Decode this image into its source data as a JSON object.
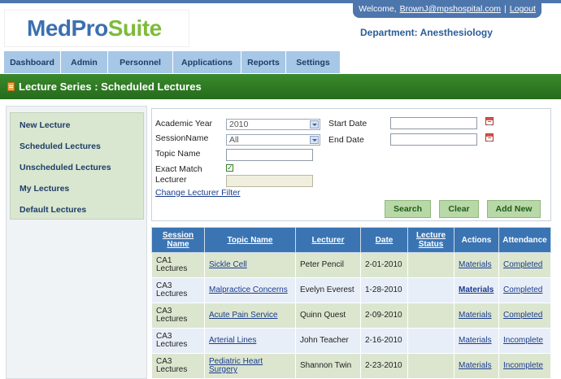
{
  "app": {
    "logo_part1": "MedPro",
    "logo_part2": "Suite",
    "welcome_prefix": "Welcome,",
    "user_email": "BrownJ@mpshospital.com",
    "separator": "|",
    "logout_label": "Logout",
    "department": "Department: Anesthesiology"
  },
  "nav": {
    "tabs": [
      "Dashboard",
      "Admin",
      "Personnel",
      "Applications",
      "Reports",
      "Settings"
    ]
  },
  "page": {
    "title": "Lecture Series : Scheduled Lectures"
  },
  "sidebar": {
    "items": [
      "New Lecture",
      "Scheduled Lectures",
      "Unscheduled Lectures",
      "My Lectures",
      "Default Lectures"
    ]
  },
  "filters": {
    "academic_year_label": "Academic Year",
    "academic_year_value": "2010",
    "session_name_label": "SessionName",
    "session_name_value": "All",
    "topic_name_label": "Topic Name",
    "topic_name_value": "",
    "exact_match_label": "Exact Match",
    "exact_match_checked": "✓",
    "lecturer_label": "Lecturer",
    "lecturer_value": "",
    "change_lecturer_label": "Change Lecturer Filter",
    "start_date_label": "Start Date",
    "end_date_label": "End Date",
    "search_label": "Search",
    "clear_label": "Clear",
    "add_new_label": "Add New"
  },
  "table": {
    "headers": {
      "session_name": "Session Name",
      "topic_name": "Topic Name",
      "lecturer": "Lecturer",
      "date": "Date",
      "lecture_status": "Lecture Status",
      "actions": "Actions",
      "attendance": "Attendance"
    },
    "rows": [
      {
        "session_name": "CA1 Lectures",
        "topic_name": "Sickle Cell",
        "lecturer": "Peter Pencil",
        "date": "2-01-2010",
        "lecture_status": "",
        "actions": "Materials",
        "attendance": "Completed"
      },
      {
        "session_name": "CA3 Lectures",
        "topic_name": "Malpractice Concerns",
        "lecturer": "Evelyn Everest",
        "date": "1-28-2010",
        "lecture_status": "",
        "actions": "Materials",
        "attendance": "Completed"
      },
      {
        "session_name": "CA3 Lectures",
        "topic_name": "Acute Pain Service",
        "lecturer": "Quinn Quest",
        "date": "2-09-2010",
        "lecture_status": "",
        "actions": "Materials",
        "attendance": "Completed"
      },
      {
        "session_name": "CA3 Lectures",
        "topic_name": "Arterial Lines",
        "lecturer": "John Teacher",
        "date": "2-16-2010",
        "lecture_status": "",
        "actions": "Materials",
        "attendance": "Incomplete"
      },
      {
        "session_name": "CA3 Lectures",
        "topic_name": "Pediatric Heart Surgery",
        "lecturer": "Shannon Twin",
        "date": "2-23-2010",
        "lecture_status": "",
        "actions": "Materials",
        "attendance": "Incomplete"
      }
    ]
  }
}
